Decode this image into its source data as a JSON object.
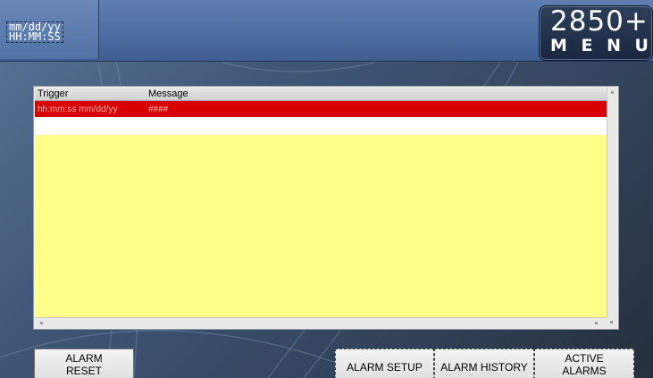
{
  "header": {
    "date_placeholder": "mm/dd/yy",
    "time_placeholder": "HH:MM:SS"
  },
  "menu": {
    "model": "2850+",
    "label_letters": [
      "M",
      "E",
      "N",
      "U"
    ]
  },
  "alarm_table": {
    "columns": [
      "Trigger",
      "Message"
    ],
    "rows": [
      {
        "trigger": "hh:mm:ss mm/dd/yy",
        "message": "####",
        "state": "active"
      }
    ],
    "colors": {
      "active_row": "#d90000",
      "body": "#ffff8a"
    }
  },
  "buttons": {
    "alarm_reset": [
      "ALARM",
      "RESET"
    ],
    "alarm_setup": "ALARM SETUP",
    "alarm_history": "ALARM HISTORY",
    "active_alarms": [
      "ACTIVE",
      "ALARMS"
    ]
  }
}
